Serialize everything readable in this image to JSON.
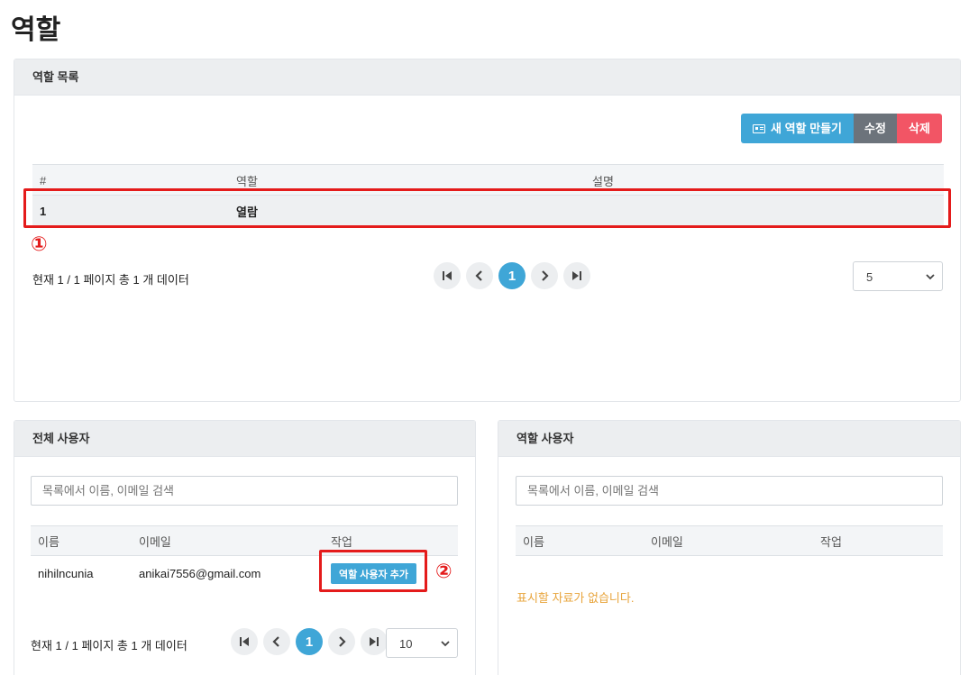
{
  "page": {
    "title": "역할"
  },
  "roles_panel": {
    "header": "역할 목록",
    "buttons": {
      "new_role": "새 역할 만들기",
      "edit": "수정",
      "delete": "삭제"
    },
    "columns": [
      "#",
      "역할",
      "설명"
    ],
    "rows": [
      {
        "num": "1",
        "role": "열람",
        "desc": ""
      }
    ],
    "page_info": "현재 1 / 1 페이지 총 1 개 데이터",
    "current_page": "1",
    "page_size": "5",
    "marker": "①"
  },
  "all_users_panel": {
    "header": "전체 사용자",
    "search_placeholder": "목록에서 이름, 이메일 검색",
    "columns": [
      "이름",
      "이메일",
      "작업"
    ],
    "rows": [
      {
        "name": "nihilncunia",
        "email": "anikai7556@gmail.com",
        "action": "역할 사용자 추가"
      }
    ],
    "page_info": "현재 1 / 1 페이지 총 1 개 데이터",
    "current_page": "1",
    "page_size": "10",
    "marker": "②"
  },
  "role_users_panel": {
    "header": "역할 사용자",
    "search_placeholder": "목록에서 이름, 이메일 검색",
    "columns": [
      "이름",
      "이메일",
      "작업"
    ],
    "empty_text": "표시할 자료가 없습니다."
  },
  "colors": {
    "primary": "#3fa6d7",
    "secondary": "#6c737b",
    "danger": "#f25565",
    "highlight": "#e41b1b",
    "warning_text": "#e8a43b"
  }
}
